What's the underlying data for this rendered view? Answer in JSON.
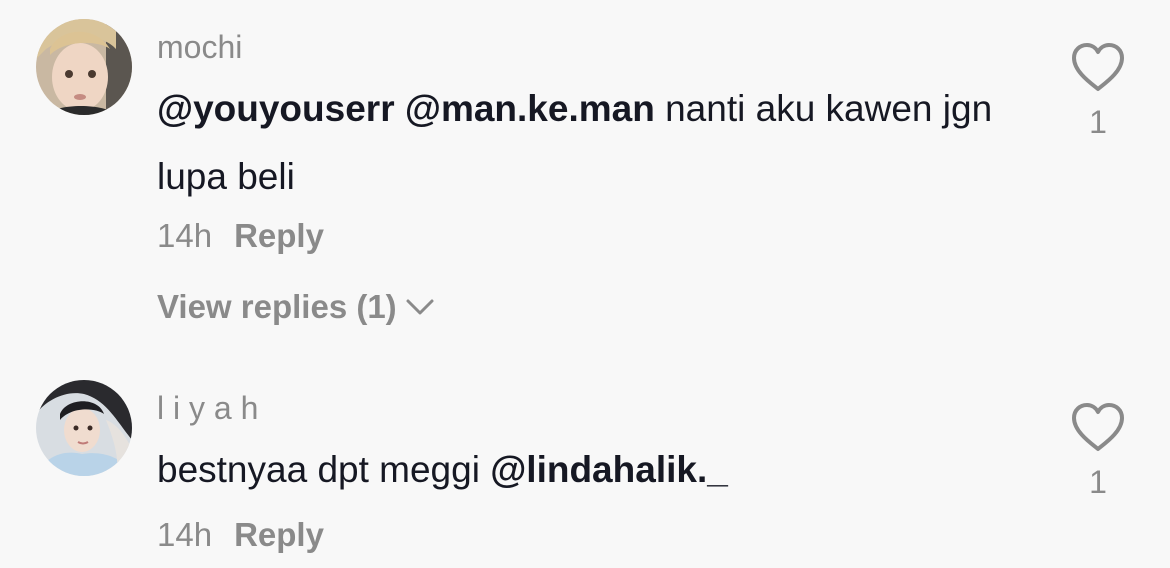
{
  "comments": [
    {
      "username": "mochi",
      "mention1": "@youyouserr",
      "mention2": "@man.ke.man",
      "text": "nanti aku kawen jgn lupa beli",
      "time": "14h",
      "reply_label": "Reply",
      "view_replies": "View replies (1)",
      "likes": "1"
    },
    {
      "username": "l i y a h",
      "text": "bestnyaa dpt meggi",
      "mention1": "@lindahalik._",
      "time": "14h",
      "reply_label": "Reply",
      "likes": "1"
    }
  ],
  "icons": {
    "like": "heart-outline-icon",
    "expand": "chevron-down-icon"
  },
  "colors": {
    "background": "#f8f8f8",
    "text": "#161823",
    "secondary": "#8a8a8a"
  }
}
